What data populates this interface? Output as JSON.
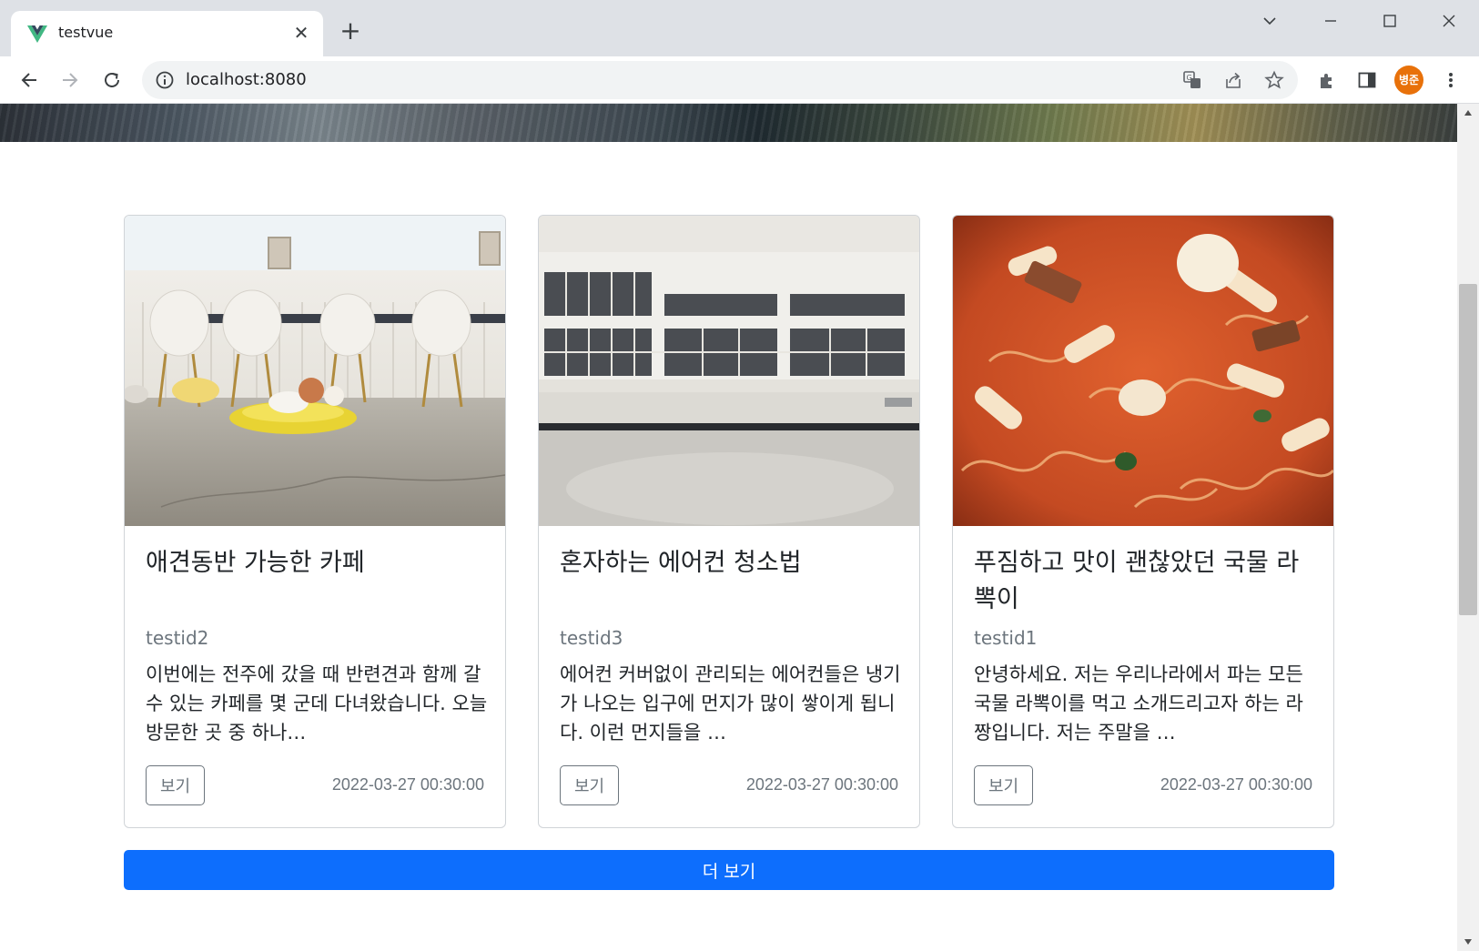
{
  "browser": {
    "tab_title": "testvue",
    "url": "localhost:8080",
    "profile_label": "병준"
  },
  "cards": [
    {
      "title": "애견동반 가능한 카페",
      "author": "testid2",
      "excerpt": "이번에는 전주에 갔을 때 반련견과 함께 갈 수 있는 카페를 몇 군데 다녀왔습니다. 오늘 방문한 곳 중 하나…",
      "button_label": "보기",
      "date": "2022-03-27 00:30:00"
    },
    {
      "title": "혼자하는 에어컨 청소법",
      "author": "testid3",
      "excerpt": "에어컨 커버없이 관리되는 에어컨들은 냉기가 나오는 입구에 먼지가 많이 쌓이게 됩니다. 이런 먼지들을 …",
      "button_label": "보기",
      "date": "2022-03-27 00:30:00"
    },
    {
      "title": "푸짐하고 맛이 괜찮았던 국물 라뽁이",
      "author": "testid1",
      "excerpt": "안녕하세요. 저는 우리나라에서 파는 모든 국물 라뽁이를 먹고 소개드리고자 하는 라짱입니다. 저는 주말을 …",
      "button_label": "보기",
      "date": "2022-03-27 00:30:00"
    }
  ],
  "more_button_label": "더 보기"
}
